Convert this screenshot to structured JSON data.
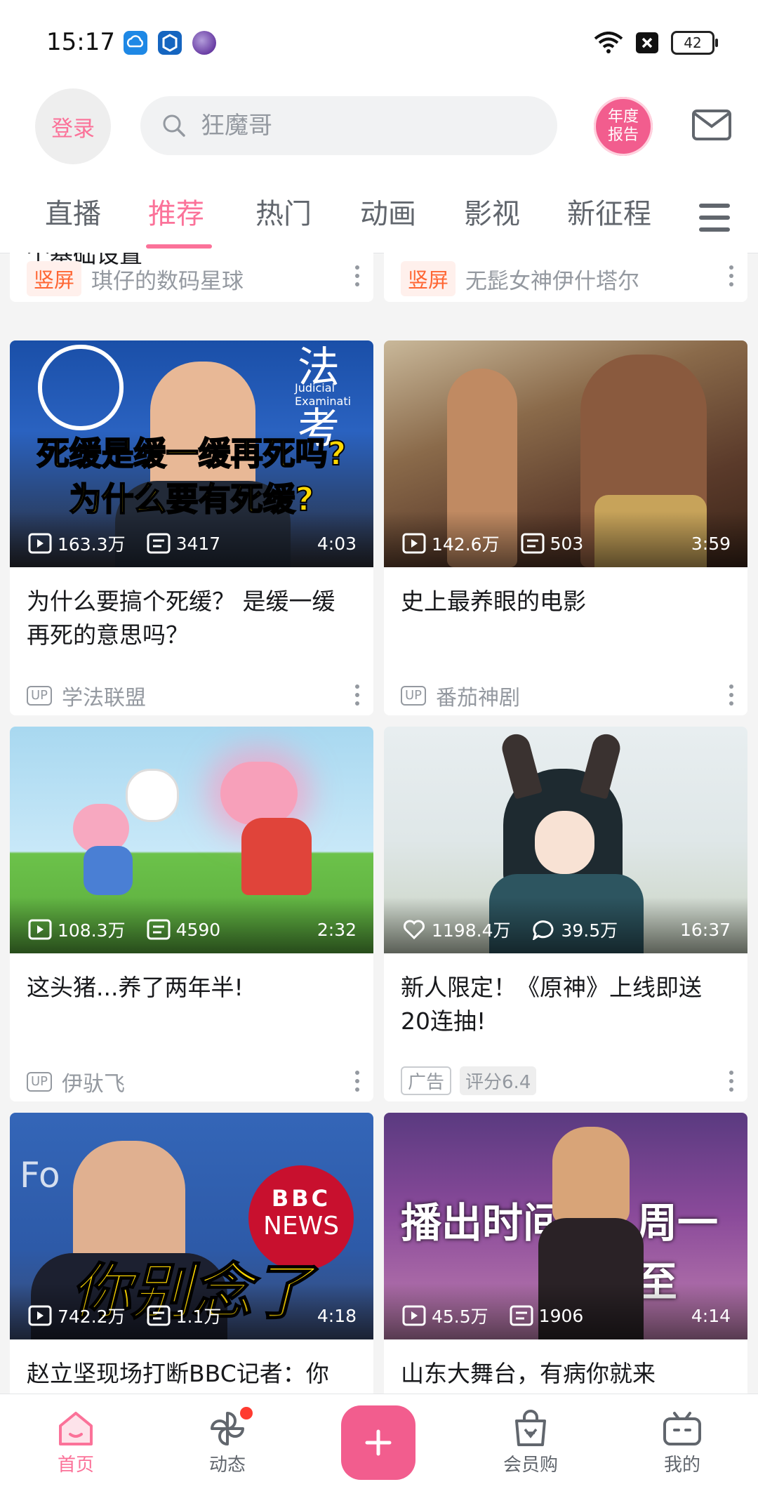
{
  "status_bar": {
    "time": "15:17",
    "battery": "42",
    "app_icons": [
      "cloud-app-icon",
      "shield-app-icon",
      "moon-app-icon"
    ],
    "signal_icons": [
      "wifi-icon",
      "no-sim-icon"
    ]
  },
  "header": {
    "login_label": "登录",
    "search_placeholder": "狂魔哥",
    "annual_report_line1": "年度",
    "annual_report_line2": "报告"
  },
  "tabs": [
    {
      "label": "直播",
      "active": false
    },
    {
      "label": "推荐",
      "active": true
    },
    {
      "label": "热门",
      "active": false
    },
    {
      "label": "动画",
      "active": false
    },
    {
      "label": "影视",
      "active": false
    },
    {
      "label": "新征程",
      "active": false
    }
  ],
  "partial_cards": [
    {
      "cut_title": "个基础设置",
      "tag": "竖屏",
      "author": "琪仔的数码星球"
    },
    {
      "cut_title": "",
      "tag": "竖屏",
      "author": "无髭女神伊什塔尔"
    }
  ],
  "cards": [
    {
      "thumb_text_1": "死缓是缓一缓再死吗?",
      "thumb_text_2": "为什么要有死缓?",
      "thumb_text_3": "Judicial Examinati",
      "thumb_text_4": "法考",
      "stat1_icon": "play-icon",
      "stat1": "163.3万",
      "stat2_icon": "danmaku-icon",
      "stat2": "3417",
      "duration": "4:03",
      "title": "为什么要搞个死缓？ 是缓一缓再死的意思吗？",
      "badge": "UP",
      "author": "学法联盟"
    },
    {
      "stat1_icon": "play-icon",
      "stat1": "142.6万",
      "stat2_icon": "danmaku-icon",
      "stat2": "503",
      "duration": "3:59",
      "title": "史上最养眼的电影",
      "badge": "UP",
      "author": "番茄神剧"
    },
    {
      "stat1_icon": "play-icon",
      "stat1": "108.3万",
      "stat2_icon": "danmaku-icon",
      "stat2": "4590",
      "duration": "2:32",
      "title": "这头猪...养了两年半!",
      "badge": "UP",
      "author": "伊驮飞"
    },
    {
      "stat1_icon": "heart-icon",
      "stat1": "1198.4万",
      "stat2_icon": "comment-icon",
      "stat2": "39.5万",
      "duration": "16:37",
      "title": "新人限定！《原神》上线即送20连抽!",
      "ad_label": "广告",
      "score": "评分6.4"
    },
    {
      "thumb_text_1": "你别念了",
      "thumb_text_2": "BBC",
      "thumb_text_3": "NEWS",
      "thumb_text_4": "Fo   n Aff",
      "stat1_icon": "play-icon",
      "stat1": "742.2万",
      "stat2_icon": "danmaku-icon",
      "stat2": "1.1万",
      "duration": "4:18",
      "title": "赵立坚现场打断BBC记者：你"
    },
    {
      "thumb_text_1": "播出时间",
      "thumb_text_2": "周一至",
      "stat1_icon": "play-icon",
      "stat1": "45.5万",
      "stat2_icon": "danmaku-icon",
      "stat2": "1906",
      "duration": "4:14",
      "title": "山东大舞台，有病你就来"
    }
  ],
  "bottom_nav": [
    {
      "label": "首页",
      "icon": "home-icon",
      "active": true
    },
    {
      "label": "动态",
      "icon": "pinwheel-icon",
      "active": false,
      "has_dot": true
    },
    {
      "label": "",
      "icon": "plus-icon"
    },
    {
      "label": "会员购",
      "icon": "shopping-bag-icon",
      "active": false
    },
    {
      "label": "我的",
      "icon": "tv-icon",
      "active": false
    }
  ],
  "colors": {
    "accent": "#fb7299",
    "text": "#18191c",
    "secondary": "#9499a0",
    "tag_orange": "#ff6633"
  }
}
